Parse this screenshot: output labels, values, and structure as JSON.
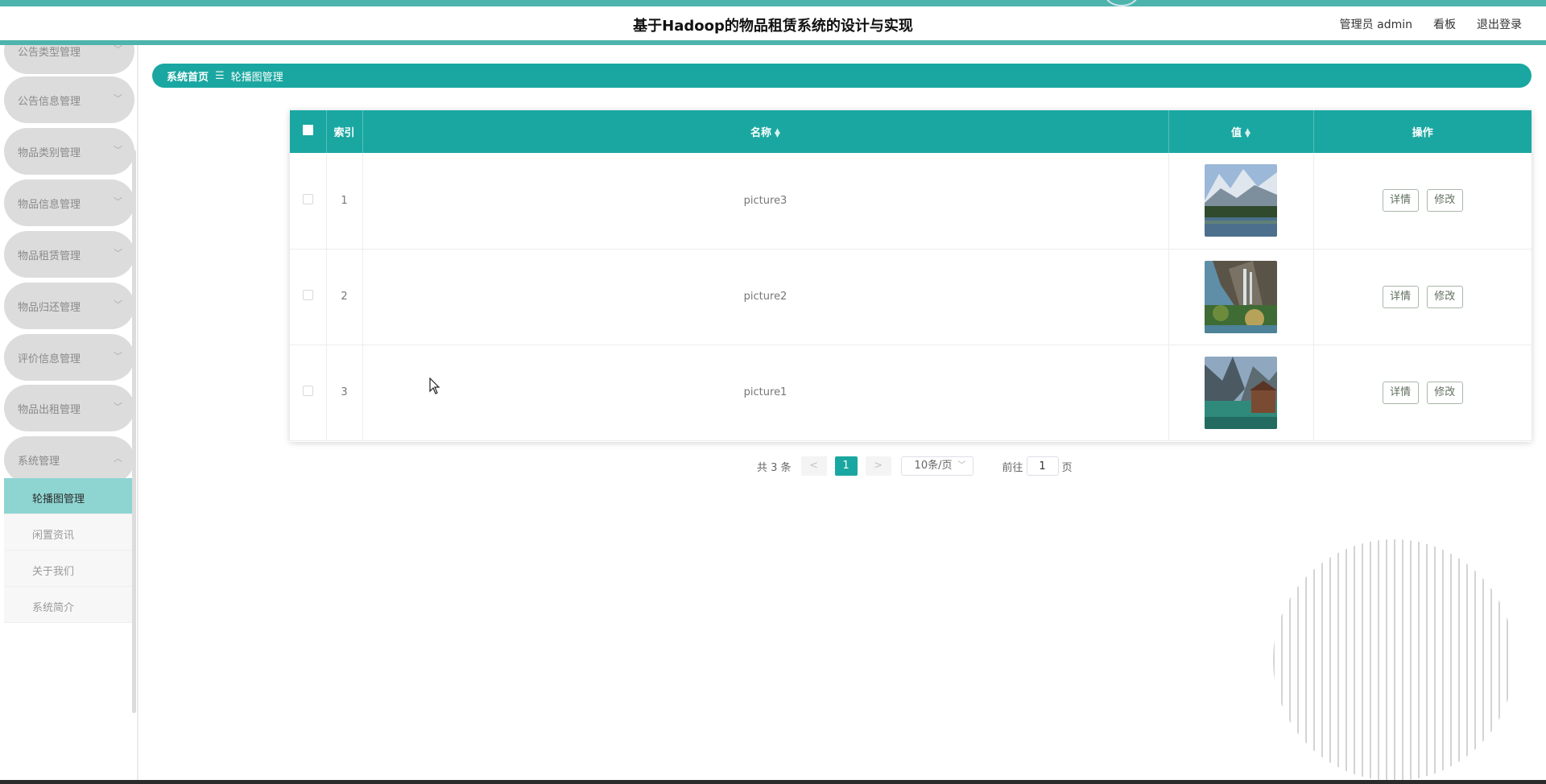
{
  "header": {
    "title": "基于Hadoop的物品租赁系统的设计与实现",
    "admin_label": "管理员 admin",
    "dashboard_link": "看板",
    "logout_link": "退出登录",
    "accent_color": "#1aa7a1"
  },
  "sidebar": {
    "menus": [
      {
        "label": "公告类型管理",
        "expanded": false
      },
      {
        "label": "公告信息管理",
        "expanded": false
      },
      {
        "label": "物品类别管理",
        "expanded": false
      },
      {
        "label": "物品信息管理",
        "expanded": false
      },
      {
        "label": "物品租赁管理",
        "expanded": false
      },
      {
        "label": "物品归还管理",
        "expanded": false
      },
      {
        "label": "评价信息管理",
        "expanded": false
      },
      {
        "label": "物品出租管理",
        "expanded": false
      },
      {
        "label": "系统管理",
        "expanded": true
      }
    ],
    "sub_items": [
      {
        "label": "轮播图管理",
        "active": true
      },
      {
        "label": "闲置资讯",
        "active": false
      },
      {
        "label": "关于我们",
        "active": false
      },
      {
        "label": "系统简介",
        "active": false
      }
    ]
  },
  "breadcrumb": {
    "home": "系统首页",
    "separator": "☰",
    "current": "轮播图管理"
  },
  "table": {
    "columns": [
      "索引",
      "名称",
      "值",
      "操作"
    ],
    "rows": [
      {
        "index": "1",
        "name": "picture3",
        "image_icon": "mountain-lake-image"
      },
      {
        "index": "2",
        "name": "picture2",
        "image_icon": "waterfall-image"
      },
      {
        "index": "3",
        "name": "picture1",
        "image_icon": "lake-boathouse-image"
      }
    ],
    "detail_label": "详情",
    "edit_label": "修改"
  },
  "pagination": {
    "total_text": "共 3 条",
    "prev": "<",
    "current_page": "1",
    "next": ">",
    "page_size": "10条/页",
    "goto_label": "前往",
    "goto_value": "1",
    "page_unit": "页"
  }
}
